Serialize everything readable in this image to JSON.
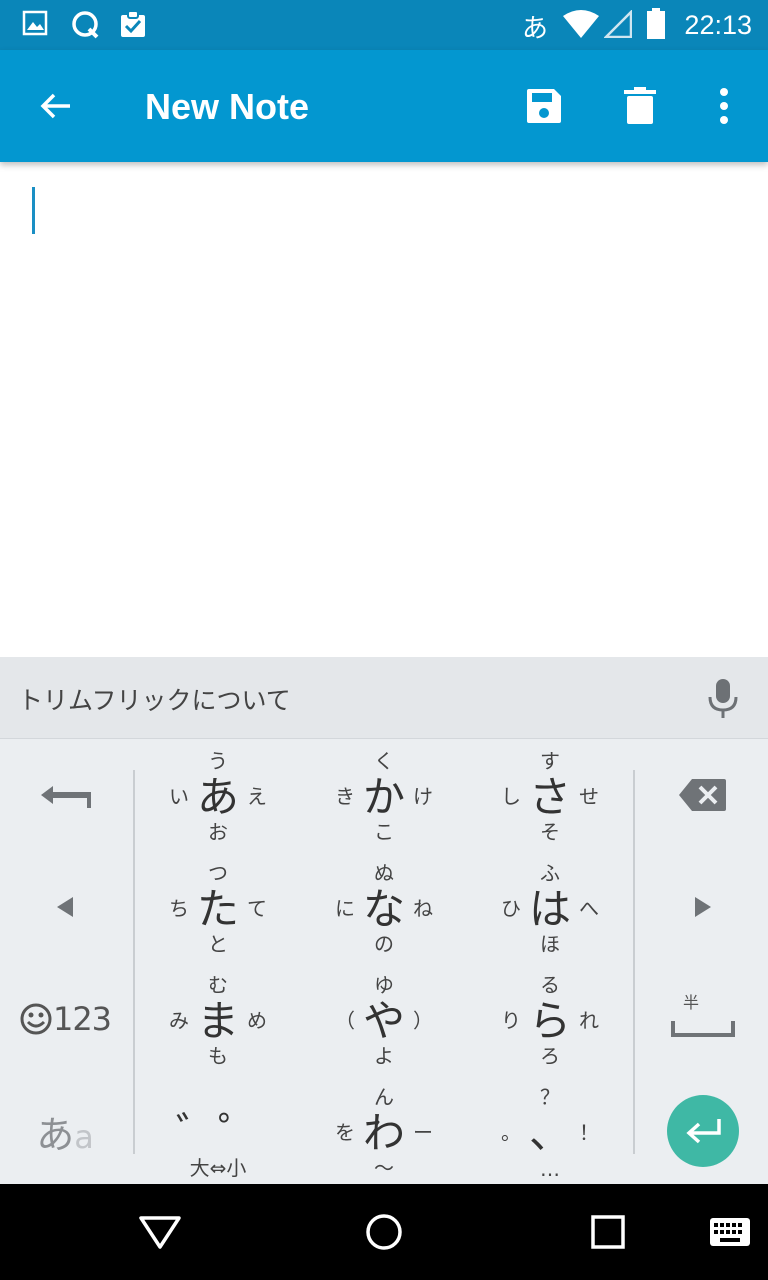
{
  "status_bar": {
    "time": "22:13",
    "ime_indicator": "あ",
    "icons": [
      "image-icon",
      "chat-icon",
      "clipboard-check-icon",
      "wifi-icon",
      "cell-signal-icon",
      "battery-icon"
    ]
  },
  "app_bar": {
    "title": "New Note",
    "icons": [
      "back-arrow-icon",
      "save-icon",
      "delete-icon",
      "more-vert-icon"
    ]
  },
  "editor": {
    "content": ""
  },
  "suggestion_bar": {
    "text": "トリムフリックについて",
    "icon": "microphone-icon"
  },
  "keyboard": {
    "keys": [
      {
        "name": "a",
        "center": "あ",
        "up": "う",
        "down": "お",
        "left": "い",
        "right": "え"
      },
      {
        "name": "ka",
        "center": "か",
        "up": "く",
        "down": "こ",
        "left": "き",
        "right": "け"
      },
      {
        "name": "sa",
        "center": "さ",
        "up": "す",
        "down": "そ",
        "left": "し",
        "right": "せ"
      },
      {
        "name": "ta",
        "center": "た",
        "up": "つ",
        "down": "と",
        "left": "ち",
        "right": "て"
      },
      {
        "name": "na",
        "center": "な",
        "up": "ぬ",
        "down": "の",
        "left": "に",
        "right": "ね"
      },
      {
        "name": "ha",
        "center": "は",
        "up": "ふ",
        "down": "ほ",
        "left": "ひ",
        "right": "へ"
      },
      {
        "name": "ma",
        "center": "ま",
        "up": "む",
        "down": "も",
        "left": "み",
        "right": "め"
      },
      {
        "name": "ya",
        "center": "や",
        "up": "ゆ",
        "down": "よ",
        "left": "（",
        "right": "）"
      },
      {
        "name": "ra",
        "center": "ら",
        "up": "る",
        "down": "ろ",
        "left": "り",
        "right": "れ"
      },
      {
        "name": "dakuten",
        "center": "゛゜",
        "up": "",
        "down": "大⇔小",
        "left": "",
        "right": ""
      },
      {
        "name": "wa",
        "center": "わ",
        "up": "ん",
        "down": "〜",
        "left": "を",
        "right": "ー"
      },
      {
        "name": "punct",
        "center": "、",
        "up": "？",
        "down": "…",
        "left": "。",
        "right": "！"
      }
    ],
    "side_labels": {
      "symbols": "123",
      "mode_main": "あ",
      "mode_sub": "a",
      "half_width": "半"
    }
  },
  "nav_bar": {
    "icons": [
      "back-triangle-icon",
      "home-circle-icon",
      "recents-square-icon",
      "keyboard-icon"
    ]
  },
  "colors": {
    "status_bar": "#0a86b9",
    "app_bar": "#0397d0",
    "cursor": "#1a8fc4",
    "enter_button": "#3fb8a5",
    "keyboard_bg": "#ebeef1",
    "suggestion_bg": "#e4e7ea"
  }
}
